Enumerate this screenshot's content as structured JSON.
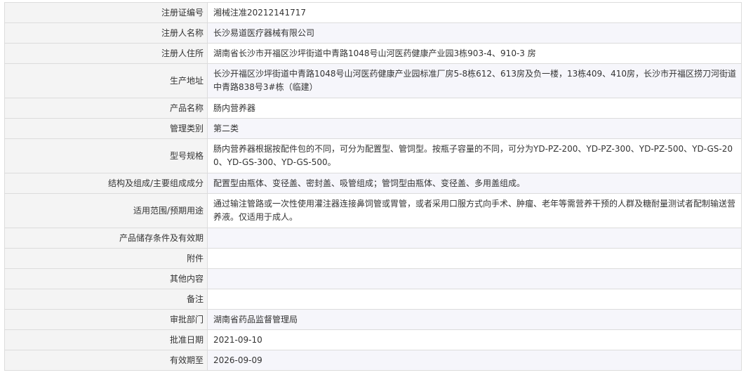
{
  "record": {
    "rows": [
      {
        "label": "注册证编号",
        "value": "湘械注准20212141717"
      },
      {
        "label": "注册人名称",
        "value": "长沙易道医疗器械有限公司"
      },
      {
        "label": "注册人住所",
        "value": "湖南省长沙市开福区沙坪街道中青路1048号山河医药健康产业园3栋903-4、910-3 房"
      },
      {
        "label": "生产地址",
        "value": "长沙开福区沙坪街道中青路1048号山河医药健康产业园标准厂房5-8栋612、613房及负一楼，13栋409、410房，长沙市开福区捞刀河街道中青路838号3#栋（临建）"
      },
      {
        "label": "产品名称",
        "value": "肠内营养器"
      },
      {
        "label": "管理类别",
        "value": "第二类"
      },
      {
        "label": "型号规格",
        "value": "肠内营养器根据按配件包的不同，可分为配置型、管饲型。按瓶子容量的不同，可分为YD-PZ-200、YD-PZ-300、YD-PZ-500、YD-GS-200、YD-GS-300、YD-GS-500。"
      },
      {
        "label": "结构及组成/主要组成成分",
        "value": "配置型由瓶体、变径盖、密封盖、吸管组成；管饲型由瓶体、变径盖、多用盖组成。"
      },
      {
        "label": "适用范围/预期用途",
        "value": "通过输注管路或一次性使用灌注器连接鼻饲管或胃管，或者采用口服方式向手术、肿瘤、老年等需营养干预的人群及糖耐量测试者配制输送营养液。仅适用于成人。"
      },
      {
        "label": "产品储存条件及有效期",
        "value": ""
      },
      {
        "label": "附件",
        "value": ""
      },
      {
        "label": "其他内容",
        "value": ""
      },
      {
        "label": "备注",
        "value": ""
      },
      {
        "label": "审批部门",
        "value": "湖南省药品监督管理局"
      },
      {
        "label": "批准日期",
        "value": "2021-09-10"
      },
      {
        "label": "有效期至",
        "value": "2026-09-09"
      }
    ]
  }
}
